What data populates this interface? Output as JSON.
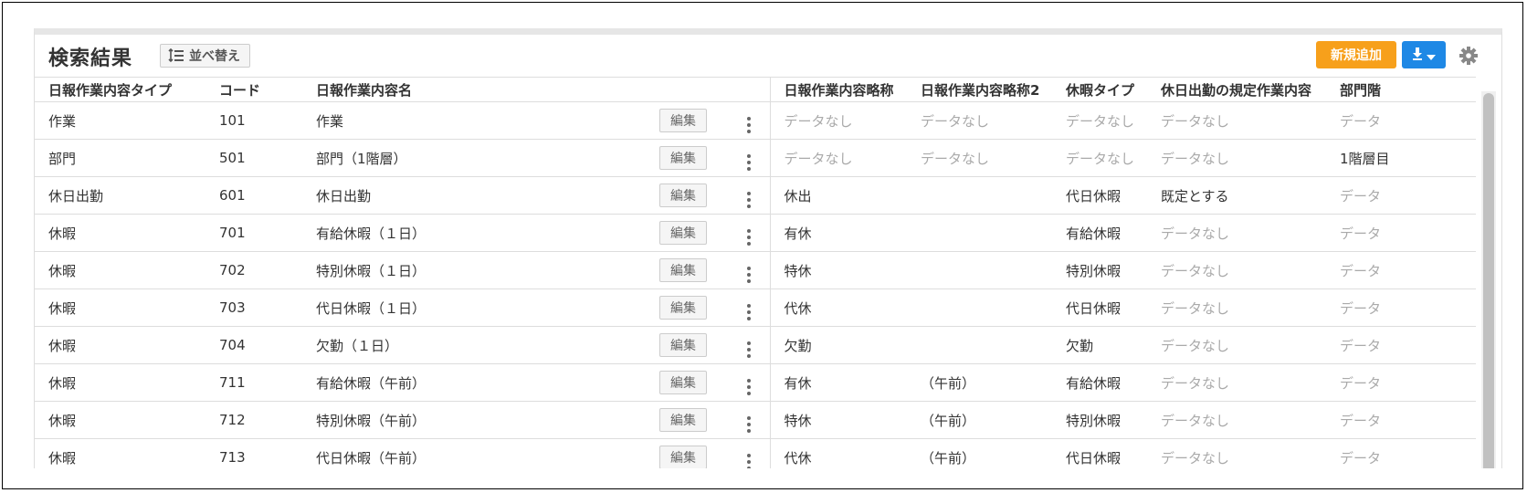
{
  "header": {
    "title": "検索結果",
    "sort_label": "並べ替え",
    "new_label": "新規追加"
  },
  "colors": {
    "new_button": "#f7a01b",
    "download_button": "#1e88e5",
    "empty_text": "#aaaaaa"
  },
  "columns": [
    "日報作業内容タイプ",
    "コード",
    "日報作業内容名",
    "日報作業内容略称",
    "日報作業内容略称2",
    "休暇タイプ",
    "休日出勤の規定作業内容",
    "部門階"
  ],
  "edit_label": "編集",
  "rows": [
    {
      "type": "作業",
      "code": "101",
      "name": "作業",
      "abbr": "データなし",
      "abbr2": "データなし",
      "leave": "データなし",
      "holiday": "データなし",
      "dept": "データ"
    },
    {
      "type": "部門",
      "code": "501",
      "name": "部門（1階層）",
      "abbr": "データなし",
      "abbr2": "データなし",
      "leave": "データなし",
      "holiday": "データなし",
      "dept": "1階層目"
    },
    {
      "type": "休日出勤",
      "code": "601",
      "name": "休日出勤",
      "abbr": "休出",
      "abbr2": "",
      "leave": "代日休暇",
      "holiday": "既定とする",
      "dept": "データ"
    },
    {
      "type": "休暇",
      "code": "701",
      "name": "有給休暇（１日）",
      "abbr": "有休",
      "abbr2": "",
      "leave": "有給休暇",
      "holiday": "データなし",
      "dept": "データ"
    },
    {
      "type": "休暇",
      "code": "702",
      "name": "特別休暇（１日）",
      "abbr": "特休",
      "abbr2": "",
      "leave": "特別休暇",
      "holiday": "データなし",
      "dept": "データ"
    },
    {
      "type": "休暇",
      "code": "703",
      "name": "代日休暇（１日）",
      "abbr": "代休",
      "abbr2": "",
      "leave": "代日休暇",
      "holiday": "データなし",
      "dept": "データ"
    },
    {
      "type": "休暇",
      "code": "704",
      "name": "欠勤（１日）",
      "abbr": "欠勤",
      "abbr2": "",
      "leave": "欠勤",
      "holiday": "データなし",
      "dept": "データ"
    },
    {
      "type": "休暇",
      "code": "711",
      "name": "有給休暇（午前）",
      "abbr": "有休",
      "abbr2": "（午前）",
      "leave": "有給休暇",
      "holiday": "データなし",
      "dept": "データ"
    },
    {
      "type": "休暇",
      "code": "712",
      "name": "特別休暇（午前）",
      "abbr": "特休",
      "abbr2": "（午前）",
      "leave": "特別休暇",
      "holiday": "データなし",
      "dept": "データ"
    },
    {
      "type": "休暇",
      "code": "713",
      "name": "代日休暇（午前）",
      "abbr": "代休",
      "abbr2": "（午前）",
      "leave": "代日休暇",
      "holiday": "データなし",
      "dept": "データ"
    }
  ]
}
